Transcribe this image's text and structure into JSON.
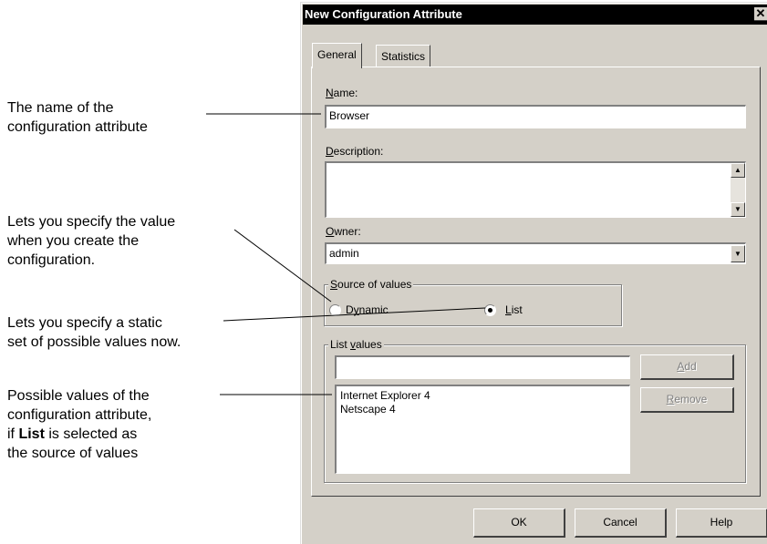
{
  "callouts": {
    "name_line1": "The name of the",
    "name_line2": "configuration attribute",
    "dynamic_line1": "Lets you specify the value",
    "dynamic_line2": "when you create the",
    "dynamic_line3": "configuration.",
    "list_line1": "Lets you specify a static",
    "list_line2": "set of possible values now.",
    "values_line1": "Possible values of the",
    "values_line2": "configuration attribute,",
    "values_line3_pre": "if ",
    "values_line3_bold": "List",
    "values_line3_post": " is selected as",
    "values_line4": "the source of values"
  },
  "dialog": {
    "title": "New Configuration Attribute",
    "close_glyph": "✕",
    "tabs": [
      {
        "label": "General"
      },
      {
        "label": "Statistics"
      }
    ],
    "name_label": "Name:",
    "name_mnemonic": "N",
    "name_rest": "ame:",
    "name_value": "Browser",
    "description_mnemonic": "D",
    "description_rest": "escription:",
    "description_value": "",
    "owner_mnemonic": "O",
    "owner_rest": "wner:",
    "owner_value": "admin",
    "source_group_mnemonic": "S",
    "source_group_rest": "ource of values",
    "dynamic_mnemonic": "y",
    "dynamic_pre": "D",
    "dynamic_rest": "namic",
    "list_radio_mnemonic": "L",
    "list_radio_rest": "ist",
    "selected_source": "List",
    "list_group_pre": "List ",
    "list_group_mnemonic": "v",
    "list_group_rest": "alues",
    "new_value": "",
    "add_mnemonic": "A",
    "add_rest": "dd",
    "remove_mnemonic": "R",
    "remove_rest": "emove",
    "values": [
      "Internet Explorer 4",
      "Netscape 4"
    ],
    "ok_label": "OK",
    "cancel_label": "Cancel",
    "help_label": "Help",
    "scroll_up_glyph": "▲",
    "scroll_down_glyph": "▼",
    "dropdown_glyph": "▼"
  }
}
